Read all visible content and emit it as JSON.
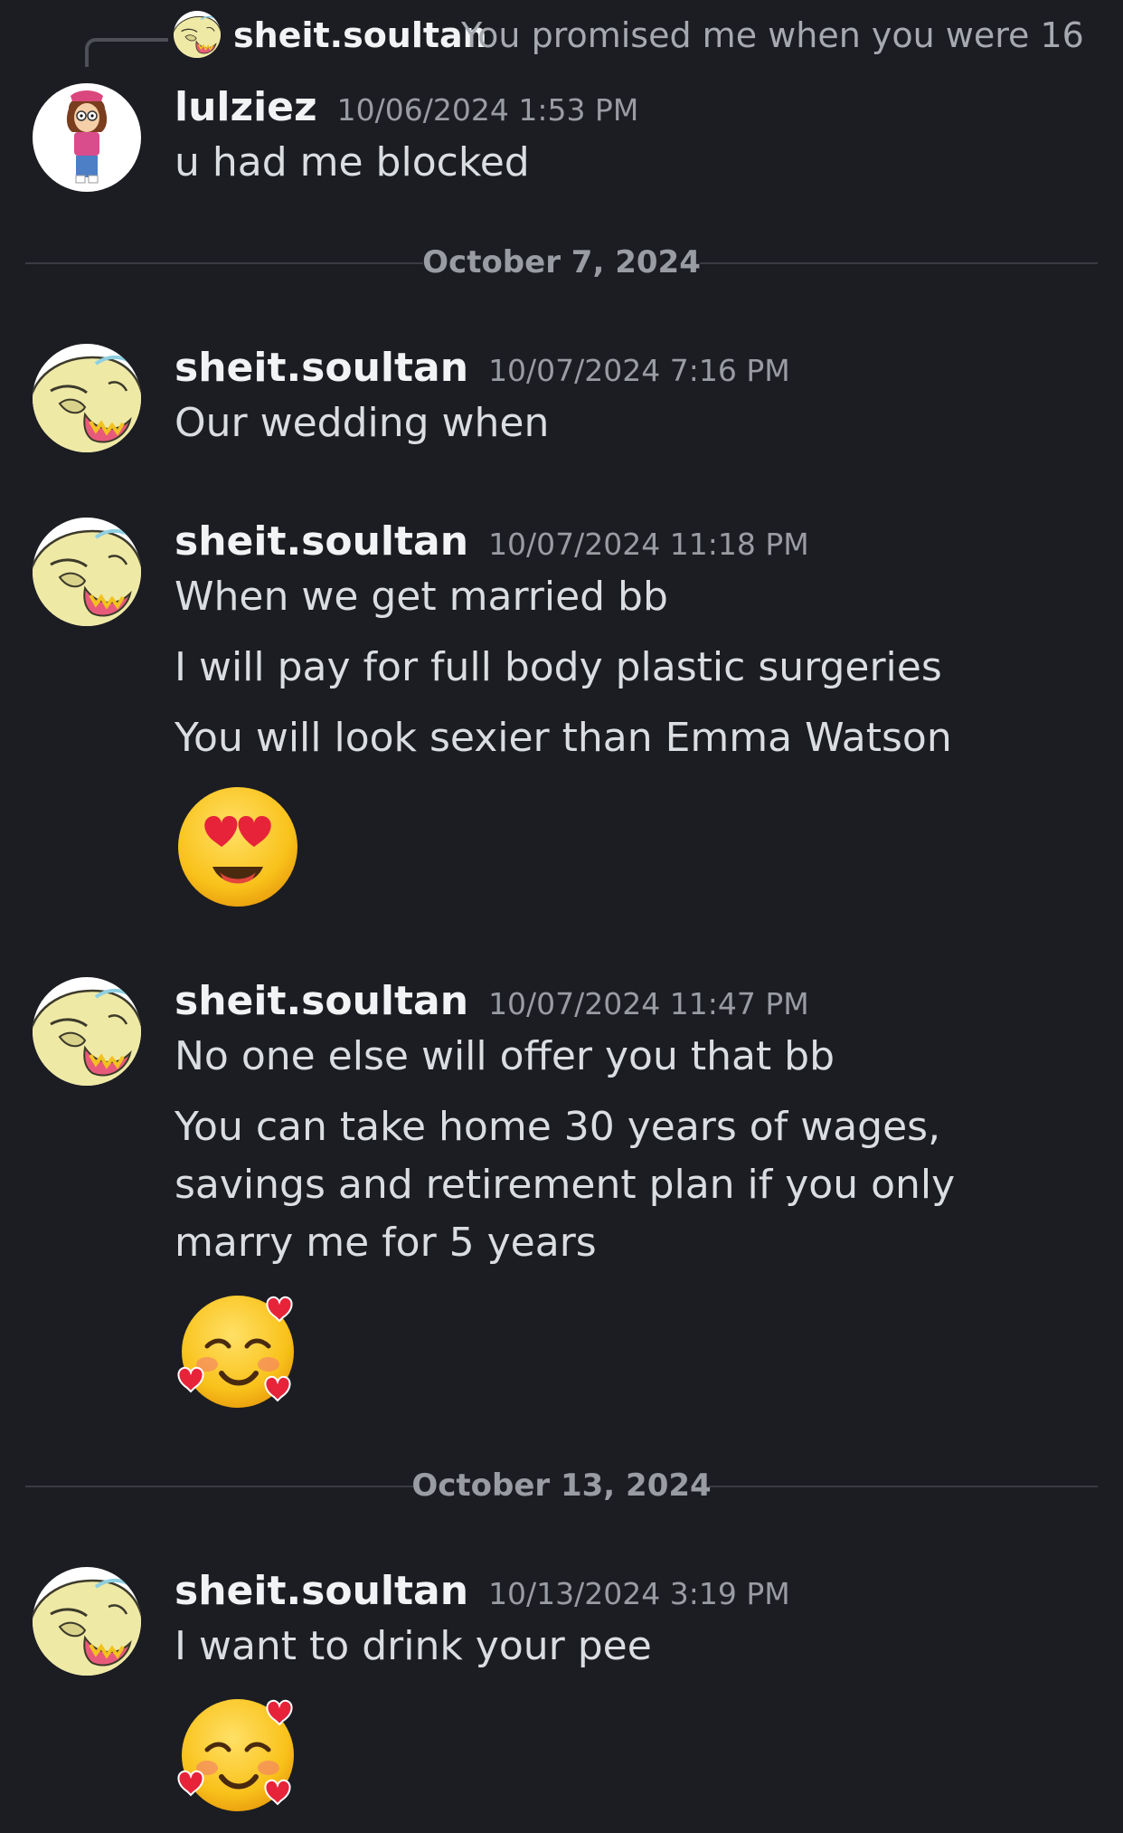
{
  "reply": {
    "username": "sheit.soultan",
    "text": "You promised me when you were 16",
    "avatar_icon": "ogre-avatar-icon"
  },
  "messages": [
    {
      "username": "lulziez",
      "timestamp": "10/06/2024 1:53 PM",
      "avatar_icon": "girl-cartoon-avatar-icon",
      "lines": [
        "u had me blocked"
      ]
    },
    {
      "username": "sheit.soultan",
      "timestamp": "10/07/2024 7:16 PM",
      "avatar_icon": "ogre-avatar-icon",
      "lines": [
        "Our wedding when"
      ]
    },
    {
      "username": "sheit.soultan",
      "timestamp": "10/07/2024 11:18 PM",
      "avatar_icon": "ogre-avatar-icon",
      "lines": [
        "When we get married bb",
        "I will pay for full body plastic surgeries",
        "You will look sexier than Emma Watson"
      ],
      "emoji": "heart-eyes-emoji"
    },
    {
      "username": "sheit.soultan",
      "timestamp": "10/07/2024 11:47 PM",
      "avatar_icon": "ogre-avatar-icon",
      "lines": [
        "No one else will offer you that bb",
        "You can take home 30 years of wages, savings and retirement plan if you only marry me for 5 years"
      ],
      "emoji": "smiling-face-with-hearts-emoji"
    },
    {
      "username": "sheit.soultan",
      "timestamp": "10/13/2024 3:19 PM",
      "avatar_icon": "ogre-avatar-icon",
      "lines": [
        "I want to drink your pee"
      ],
      "emoji": "smiling-face-with-hearts-emoji"
    }
  ],
  "dividers": [
    "October 7, 2024",
    "October 13, 2024"
  ],
  "colors": {
    "background": "#1c1d22",
    "username": "#f2f3f5",
    "message_text": "#dbdee1",
    "muted": "#9a9ca3",
    "divider_rule": "#3a3c43"
  }
}
